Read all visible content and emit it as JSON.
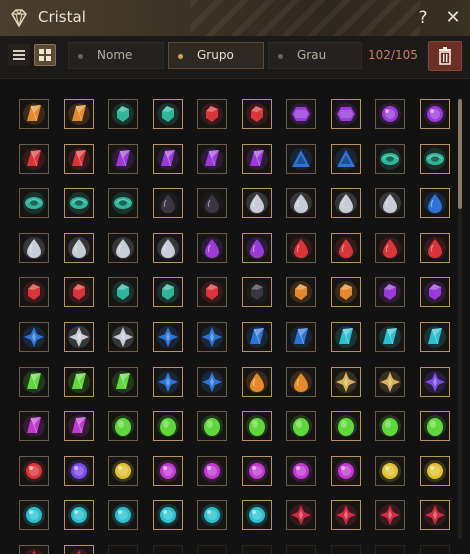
{
  "window": {
    "title": "Cristal",
    "help_icon": "?",
    "close_icon": "✕"
  },
  "toolbar": {
    "sort_options": [
      {
        "label": "Nome",
        "active": false
      },
      {
        "label": "Grupo",
        "active": true
      },
      {
        "label": "Grau",
        "active": false
      }
    ],
    "count": "102/105",
    "icons": [
      "list-view-icon",
      "grid-view-icon",
      "trash-icon"
    ]
  },
  "colors": {
    "orange": "#e58a2a",
    "red": "#d8343a",
    "purple": "#9a3ad8",
    "teal": "#2fb59a",
    "silver": "#c7ccd6",
    "black": "#3a3540",
    "blue": "#2c74d8",
    "gold": "#d6b35a",
    "green": "#5ed83a",
    "violet": "#7a4ae8",
    "amber": "#e0c230",
    "magenta": "#c03ad0",
    "cyan": "#2ac0d0",
    "crimson": "#d02a45"
  },
  "grid": {
    "rows": [
      [
        {
          "s": "shard",
          "c": "orange"
        },
        {
          "s": "shard",
          "c": "orange"
        },
        {
          "s": "gem",
          "c": "teal"
        },
        {
          "s": "gem",
          "c": "teal"
        },
        {
          "s": "gem",
          "c": "red"
        },
        {
          "s": "gem",
          "c": "red"
        },
        {
          "s": "hex",
          "c": "purple"
        },
        {
          "s": "hex",
          "c": "purple"
        },
        {
          "s": "round",
          "c": "purple"
        },
        {
          "s": "round",
          "c": "purple"
        }
      ],
      [
        {
          "s": "shard",
          "c": "red"
        },
        {
          "s": "shard",
          "c": "red"
        },
        {
          "s": "shard",
          "c": "purple"
        },
        {
          "s": "shard",
          "c": "purple"
        },
        {
          "s": "shard",
          "c": "purple"
        },
        {
          "s": "shard",
          "c": "purple"
        },
        {
          "s": "tri",
          "c": "blue"
        },
        {
          "s": "tri",
          "c": "blue"
        },
        {
          "s": "eye",
          "c": "teal"
        },
        {
          "s": "eye",
          "c": "teal"
        }
      ],
      [
        {
          "s": "eye",
          "c": "teal"
        },
        {
          "s": "eye",
          "c": "teal"
        },
        {
          "s": "eye",
          "c": "teal"
        },
        {
          "s": "drop",
          "c": "black"
        },
        {
          "s": "drop",
          "c": "black"
        },
        {
          "s": "drop",
          "c": "silver"
        },
        {
          "s": "drop",
          "c": "silver"
        },
        {
          "s": "drop",
          "c": "silver"
        },
        {
          "s": "drop",
          "c": "silver"
        },
        {
          "s": "drop",
          "c": "blue"
        }
      ],
      [
        {
          "s": "drop",
          "c": "silver"
        },
        {
          "s": "drop",
          "c": "silver"
        },
        {
          "s": "drop",
          "c": "silver"
        },
        {
          "s": "drop",
          "c": "silver"
        },
        {
          "s": "drop",
          "c": "purple"
        },
        {
          "s": "drop",
          "c": "purple"
        },
        {
          "s": "drop",
          "c": "red"
        },
        {
          "s": "drop",
          "c": "red"
        },
        {
          "s": "drop",
          "c": "red"
        },
        {
          "s": "drop",
          "c": "red"
        }
      ],
      [
        {
          "s": "gem",
          "c": "red"
        },
        {
          "s": "gem",
          "c": "red"
        },
        {
          "s": "gem",
          "c": "teal"
        },
        {
          "s": "gem",
          "c": "teal"
        },
        {
          "s": "gem",
          "c": "red"
        },
        {
          "s": "gem",
          "c": "black"
        },
        {
          "s": "gem",
          "c": "orange"
        },
        {
          "s": "gem",
          "c": "orange"
        },
        {
          "s": "gem",
          "c": "purple"
        },
        {
          "s": "gem",
          "c": "purple"
        }
      ],
      [
        {
          "s": "star",
          "c": "blue"
        },
        {
          "s": "star",
          "c": "silver"
        },
        {
          "s": "star",
          "c": "silver"
        },
        {
          "s": "star",
          "c": "blue"
        },
        {
          "s": "star",
          "c": "blue"
        },
        {
          "s": "shard",
          "c": "blue"
        },
        {
          "s": "shard",
          "c": "blue"
        },
        {
          "s": "shard",
          "c": "cyan"
        },
        {
          "s": "shard",
          "c": "cyan"
        },
        {
          "s": "shard",
          "c": "cyan"
        }
      ],
      [
        {
          "s": "shard",
          "c": "green"
        },
        {
          "s": "shard",
          "c": "green"
        },
        {
          "s": "shard",
          "c": "green"
        },
        {
          "s": "star",
          "c": "blue"
        },
        {
          "s": "star",
          "c": "blue"
        },
        {
          "s": "drop",
          "c": "orange"
        },
        {
          "s": "drop",
          "c": "orange"
        },
        {
          "s": "star",
          "c": "gold"
        },
        {
          "s": "star",
          "c": "gold"
        },
        {
          "s": "star",
          "c": "violet"
        }
      ],
      [
        {
          "s": "shard",
          "c": "magenta"
        },
        {
          "s": "shard",
          "c": "magenta"
        },
        {
          "s": "oval",
          "c": "green"
        },
        {
          "s": "oval",
          "c": "green"
        },
        {
          "s": "oval",
          "c": "green"
        },
        {
          "s": "oval",
          "c": "green"
        },
        {
          "s": "oval",
          "c": "green"
        },
        {
          "s": "oval",
          "c": "green"
        },
        {
          "s": "oval",
          "c": "green"
        },
        {
          "s": "oval",
          "c": "green"
        }
      ],
      [
        {
          "s": "round",
          "c": "red"
        },
        {
          "s": "round",
          "c": "violet"
        },
        {
          "s": "round",
          "c": "amber"
        },
        {
          "s": "round",
          "c": "magenta"
        },
        {
          "s": "round",
          "c": "magenta"
        },
        {
          "s": "round",
          "c": "magenta"
        },
        {
          "s": "round",
          "c": "magenta"
        },
        {
          "s": "round",
          "c": "magenta"
        },
        {
          "s": "round",
          "c": "amber"
        },
        {
          "s": "round",
          "c": "amber"
        }
      ],
      [
        {
          "s": "round",
          "c": "cyan"
        },
        {
          "s": "round",
          "c": "cyan"
        },
        {
          "s": "round",
          "c": "cyan"
        },
        {
          "s": "round",
          "c": "cyan"
        },
        {
          "s": "round",
          "c": "cyan"
        },
        {
          "s": "round",
          "c": "cyan"
        },
        {
          "s": "star",
          "c": "crimson"
        },
        {
          "s": "star",
          "c": "crimson"
        },
        {
          "s": "star",
          "c": "crimson"
        },
        {
          "s": "star",
          "c": "crimson"
        }
      ],
      [
        {
          "s": "star",
          "c": "crimson"
        },
        {
          "s": "star",
          "c": "crimson"
        },
        {
          "s": "empty",
          "c": "black"
        },
        {
          "s": "empty",
          "c": "black"
        },
        {
          "s": "empty",
          "c": "black"
        },
        {
          "s": "empty",
          "c": "black"
        },
        {
          "s": "empty",
          "c": "black"
        },
        {
          "s": "empty",
          "c": "black"
        },
        {
          "s": "empty",
          "c": "black"
        },
        {
          "s": "empty",
          "c": "black"
        }
      ]
    ]
  }
}
